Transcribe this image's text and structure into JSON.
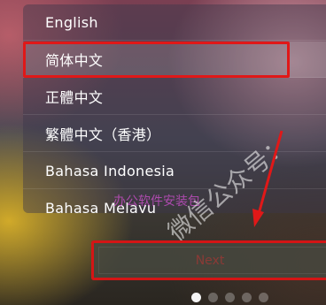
{
  "languages": [
    {
      "label": "English",
      "selected": false
    },
    {
      "label": "简体中文",
      "selected": true
    },
    {
      "label": "正體中文",
      "selected": false
    },
    {
      "label": "繁體中文（香港）",
      "selected": false
    },
    {
      "label": "Bahasa Indonesia",
      "selected": false
    },
    {
      "label": "Bahasa Melayu",
      "selected": false
    }
  ],
  "next_button": {
    "label": "Next"
  },
  "watermark": {
    "main": "微信公众号：",
    "sub": "办公软件安装包"
  },
  "pagination": {
    "total": 5,
    "current": 1
  },
  "colors": {
    "highlight": "#e01818",
    "next_text": "#8a3a36",
    "watermark_sub": "#d250d2"
  }
}
